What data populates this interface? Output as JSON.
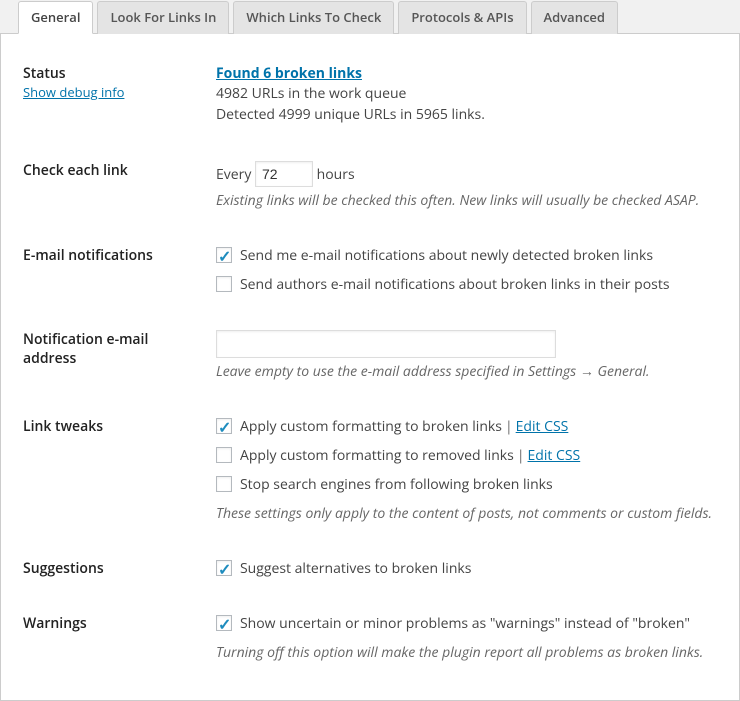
{
  "tabs": {
    "general": "General",
    "look_for": "Look For Links In",
    "which_links": "Which Links To Check",
    "protocols": "Protocols & APIs",
    "advanced": "Advanced"
  },
  "status": {
    "heading": "Status",
    "debug_link": "Show debug info",
    "broken_link": "Found 6 broken links",
    "queue_line": "4982 URLs in the work queue",
    "detected_line": "Detected 4999 unique URLs in 5965 links."
  },
  "check_each": {
    "heading": "Check each link",
    "prefix": "Every",
    "value": "72",
    "suffix": "hours",
    "desc": "Existing links will be checked this often. New links will usually be checked ASAP."
  },
  "email_notif": {
    "heading": "E-mail notifications",
    "opt1": "Send me e-mail notifications about newly detected broken links",
    "opt2": "Send authors e-mail notifications about broken links in their posts"
  },
  "notif_addr": {
    "heading": "Notification e-mail address",
    "value": "",
    "desc": "Leave empty to use the e-mail address specified in Settings → General."
  },
  "link_tweaks": {
    "heading": "Link tweaks",
    "opt1": "Apply custom formatting to broken links",
    "opt2": "Apply custom formatting to removed links",
    "opt3": "Stop search engines from following broken links",
    "edit_css": "Edit CSS",
    "sep": "|",
    "desc": "These settings only apply to the content of posts, not comments or custom fields."
  },
  "suggestions": {
    "heading": "Suggestions",
    "opt1": "Suggest alternatives to broken links"
  },
  "warnings": {
    "heading": "Warnings",
    "opt1": "Show uncertain or minor problems as \"warnings\" instead of \"broken\"",
    "desc": "Turning off this option will make the plugin report all problems as broken links."
  }
}
